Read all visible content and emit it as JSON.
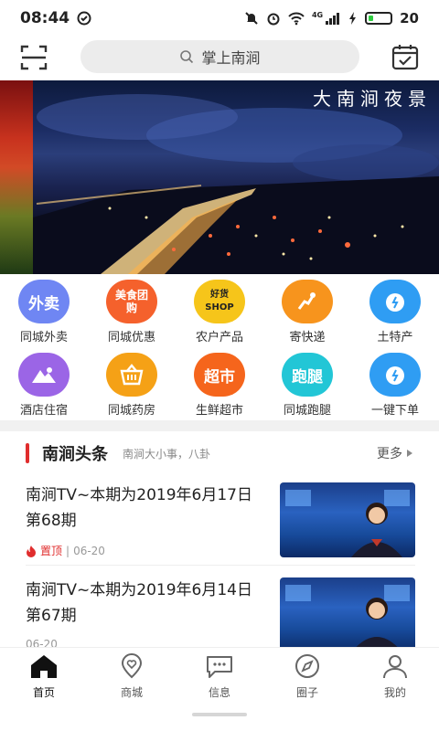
{
  "status_bar": {
    "time": "08:44",
    "battery_level": "20",
    "battery_fraction": 0.2,
    "network": "4G"
  },
  "header": {
    "search_placeholder": "掌上南涧"
  },
  "banner": {
    "title": "大南涧夜景"
  },
  "services": [
    {
      "label": "同城外卖",
      "icon_text": "外卖",
      "color": "#6f86f3"
    },
    {
      "label": "同城优惠",
      "icon_text": "美食团购",
      "color": "#f5612c"
    },
    {
      "label": "农户产品",
      "icon_text": "好货SHOP",
      "color": "#f6c51a"
    },
    {
      "label": "寄快递",
      "icon_text": "",
      "color": "#f7941d"
    },
    {
      "label": "土特产",
      "icon_text": "",
      "color": "#2f9df3"
    },
    {
      "label": "酒店住宿",
      "icon_text": "",
      "color": "#9b65e6"
    },
    {
      "label": "同城药房",
      "icon_text": "",
      "color": "#f5a116"
    },
    {
      "label": "生鲜超市",
      "icon_text": "超市",
      "color": "#f5651c"
    },
    {
      "label": "同城跑腿",
      "icon_text": "跑腿",
      "color": "#22c6d6"
    },
    {
      "label": "一键下单",
      "icon_text": "",
      "color": "#2f9df3"
    }
  ],
  "news": {
    "title": "南涧头条",
    "subtitle": "南涧大小事，八卦",
    "more_label": "更多",
    "items": [
      {
        "title": "南涧TV~本期为2019年6月17日　第68期",
        "tag": "置顶",
        "date": "06-20"
      },
      {
        "title": "南涧TV~本期为2019年6月14日　第67期",
        "tag": "",
        "date": "06-20"
      }
    ]
  },
  "bottom_nav": [
    {
      "label": "首页",
      "icon": "home-icon",
      "active": true
    },
    {
      "label": "商城",
      "icon": "location-heart-icon",
      "active": false
    },
    {
      "label": "信息",
      "icon": "chat-icon",
      "active": false
    },
    {
      "label": "圈子",
      "icon": "compass-icon",
      "active": false
    },
    {
      "label": "我的",
      "icon": "user-icon",
      "active": false
    }
  ]
}
